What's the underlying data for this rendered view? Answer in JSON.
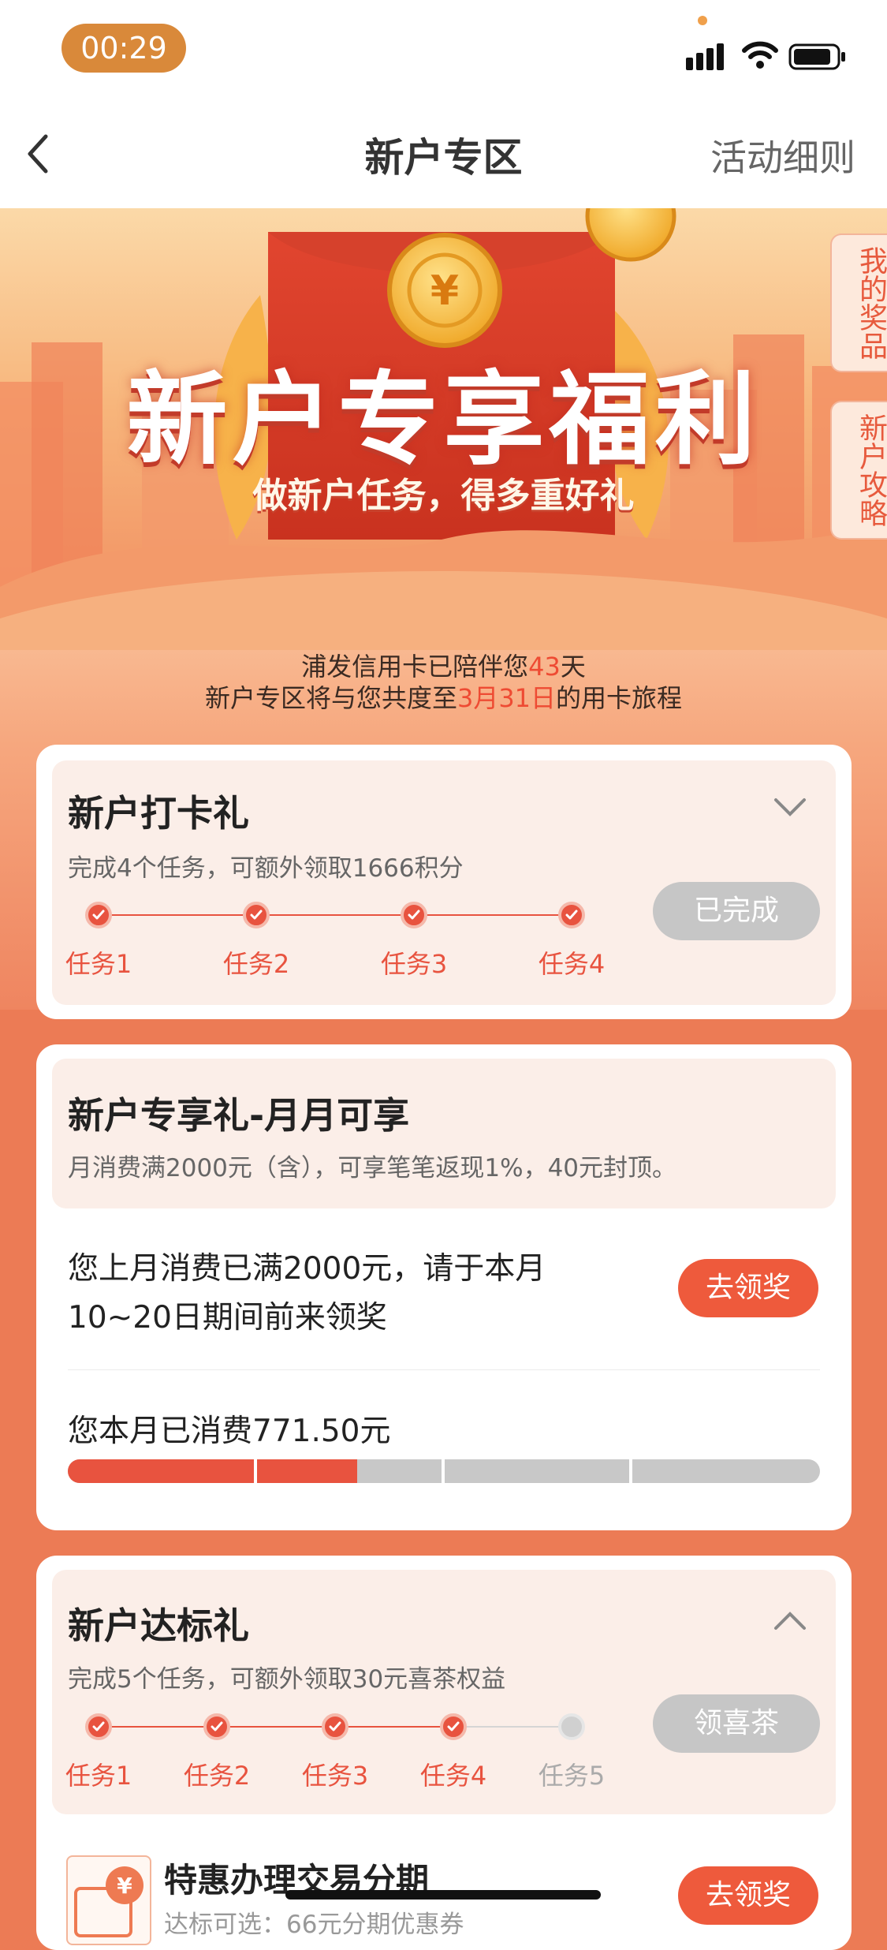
{
  "status_bar": {
    "time": "00:29"
  },
  "nav": {
    "back_icon": "chevron-left-icon",
    "title": "新户专区",
    "rules": "活动细则"
  },
  "banner": {
    "title": "新户专享福利",
    "subtitle": "做新户任务，得多重好礼",
    "ribbon_prizes": "我的奖品",
    "ribbon_guide": "新户攻略"
  },
  "intro": {
    "line1_prefix": "浦发信用卡已陪伴您",
    "days": "43",
    "line1_suffix": "天",
    "line2_prefix": "新户专区将与您共度至",
    "end_date": "3月31日",
    "line2_suffix": "的用卡旅程"
  },
  "checkin": {
    "title": "新户打卡礼",
    "desc": "完成4个任务，可额外领取1666积分",
    "button": "已完成",
    "tasks": [
      {
        "label": "任务1",
        "done": true
      },
      {
        "label": "任务2",
        "done": true
      },
      {
        "label": "任务3",
        "done": true
      },
      {
        "label": "任务4",
        "done": true
      }
    ]
  },
  "monthly": {
    "title": "新户专享礼-月月可享",
    "desc": "月消费满2000元（含），可享笔笔返现1%，40元封顶。",
    "message": "您上月消费已满2000元，请于本月10~20日期间前来领奖",
    "claim_button": "去领奖",
    "spent_text": "您本月已消费771.50元",
    "progress": 0.385
  },
  "target": {
    "title": "新户达标礼",
    "desc": "完成5个任务，可额外领取30元喜茶权益",
    "button": "领喜茶",
    "tasks": [
      {
        "label": "任务1",
        "done": true
      },
      {
        "label": "任务2",
        "done": true
      },
      {
        "label": "任务3",
        "done": true
      },
      {
        "label": "任务4",
        "done": true
      },
      {
        "label": "任务5",
        "done": false
      }
    ],
    "offer": {
      "icon": "installment-icon",
      "title": "特惠办理交易分期",
      "desc": "达标可选：66元分期优惠券",
      "claim_button": "去领奖"
    }
  },
  "colors": {
    "accent": "#e8533f",
    "brand_bg": "#ec7b55",
    "card_head": "#fbeee8"
  }
}
